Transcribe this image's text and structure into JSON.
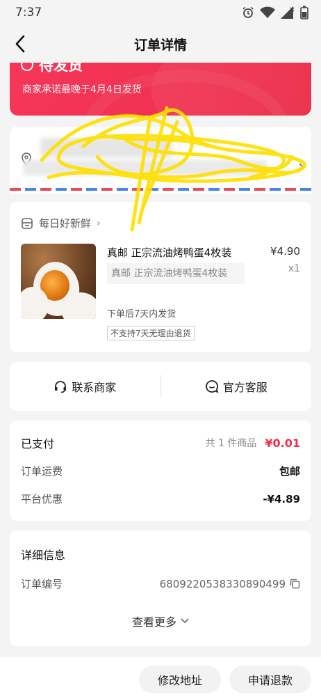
{
  "status_bar": {
    "time": "7:37"
  },
  "nav": {
    "title": "订单详情"
  },
  "banner": {
    "status": "待发货",
    "note": "商家承诺最晚于4月4日发货"
  },
  "address": {
    "name_line": "",
    "address_line": ""
  },
  "shop": {
    "name": "每日好新鲜"
  },
  "product": {
    "title": "真邮 正宗流油烤鸭蛋4枚装",
    "price": "¥4.90",
    "quantity": "x1",
    "spec": "真邮 正宗流油烤鸭蛋4枚装",
    "ship_note": "下单后7天内发货",
    "tag": "不支持7天无理由退货"
  },
  "contact": {
    "merchant": "联系商家",
    "service": "官方客服"
  },
  "payment": {
    "paid_label": "已支付",
    "item_count": "共 1 件商品",
    "paid_amount": "¥0.01",
    "shipping_label": "订单运费",
    "shipping_value": "包邮",
    "discount_label": "平台优惠",
    "discount_value": "-¥4.89"
  },
  "details": {
    "title": "详细信息",
    "order_no_label": "订单编号",
    "order_no": "6809220538330890499",
    "more": "查看更多"
  },
  "actions": {
    "modify_address": "修改地址",
    "refund": "申请退款"
  },
  "colors": {
    "accent": "#f0304a",
    "banner": "#f5365a"
  }
}
